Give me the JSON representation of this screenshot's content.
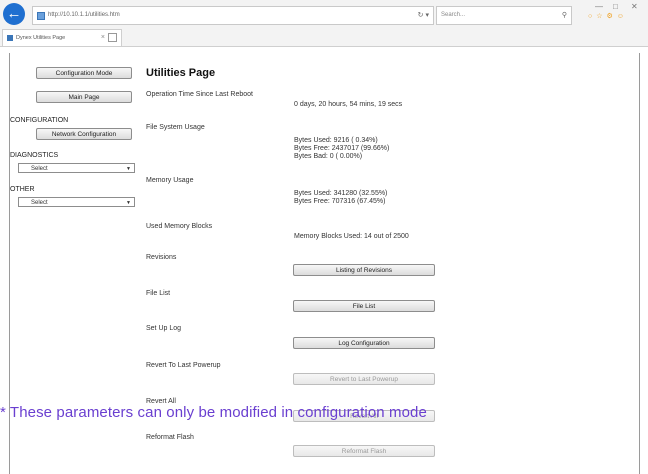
{
  "browser": {
    "url": "http://10.10.1.1/utilities.htm",
    "search_placeholder": "Search...",
    "tab_title": "Dynex Utilities Page"
  },
  "sidebar": {
    "config_mode_btn": "Configuration Mode",
    "main_page_btn": "Main Page",
    "configuration_heading": "CONFIGURATION",
    "network_config_btn": "Network Configuration",
    "diagnostics_heading": "DIAGNOSTICS",
    "diagnostics_select": "Select",
    "other_heading": "OTHER",
    "other_select": "Select"
  },
  "main": {
    "title": "Utilities Page",
    "op_time_label": "Operation Time Since Last Reboot",
    "op_time_value": "0 days, 20 hours, 54 mins, 19 secs",
    "fs_label": "File System Usage",
    "fs_used": "Bytes Used: 9216 ( 0.34%)",
    "fs_free": "Bytes Free: 2437017 (99.66%)",
    "fs_bad": "Bytes Bad: 0 ( 0.00%)",
    "mem_label": "Memory Usage",
    "mem_used": "Bytes Used: 341280 (32.55%)",
    "mem_free": "Bytes Free: 707316 (67.45%)",
    "blocks_label": "Used Memory Blocks",
    "blocks_value": "Memory Blocks Used: 14 out of 2500",
    "revisions_label": "Revisions",
    "revisions_btn": "Listing of Revisions",
    "filelist_label": "File List",
    "filelist_btn": "File List",
    "setup_log_label": "Set Up Log",
    "log_config_btn": "Log Configuration",
    "revert_label": "Revert To Last Powerup",
    "revert_btn": "Revert to Last Powerup",
    "reset_all_label": "Revert All",
    "reset_all_btn": "Revert All",
    "reformat_label": "Reformat Flash",
    "reformat_btn": "Reformat Flash"
  },
  "overlay_note": "* These parameters can only be modified in configuration mode"
}
